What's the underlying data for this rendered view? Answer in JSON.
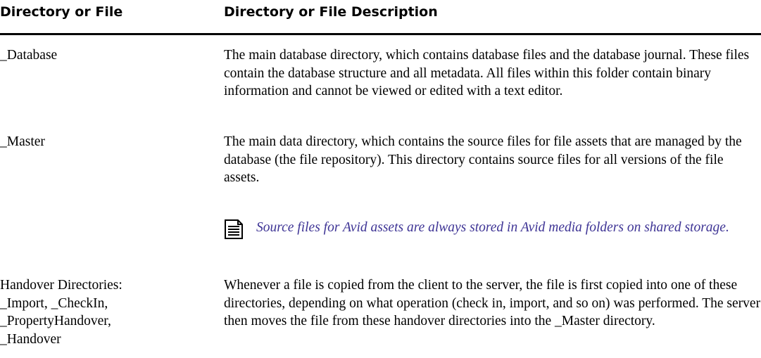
{
  "table": {
    "headers": [
      "Directory or File",
      "Directory or File Description"
    ],
    "rows": [
      {
        "name": "_Database",
        "description": "The main database directory, which contains database files and the database journal. These files contain the database structure and all metadata. All files within this folder contain binary information and cannot be viewed or edited with a text editor."
      },
      {
        "name": "_Master",
        "description": "The main data directory, which contains the source files for file assets that are managed by the database (the file repository). This directory contains source files for all versions of the file assets.",
        "note": "Source files for Avid assets are always stored in Avid media folders on shared storage."
      },
      {
        "name_lines": [
          "Handover Directories:",
          "_Import, _CheckIn,",
          "_PropertyHandover,",
          "_Handover"
        ],
        "description": "Whenever a file is copied from the client to the server, the file is first copied into one of these directories, depending on what operation (check in, import, and so on) was performed. The server then moves the file from these handover directories into the _Master directory."
      }
    ]
  },
  "icons": {
    "note": "note-icon"
  },
  "colors": {
    "note_text": "#3e3495"
  }
}
